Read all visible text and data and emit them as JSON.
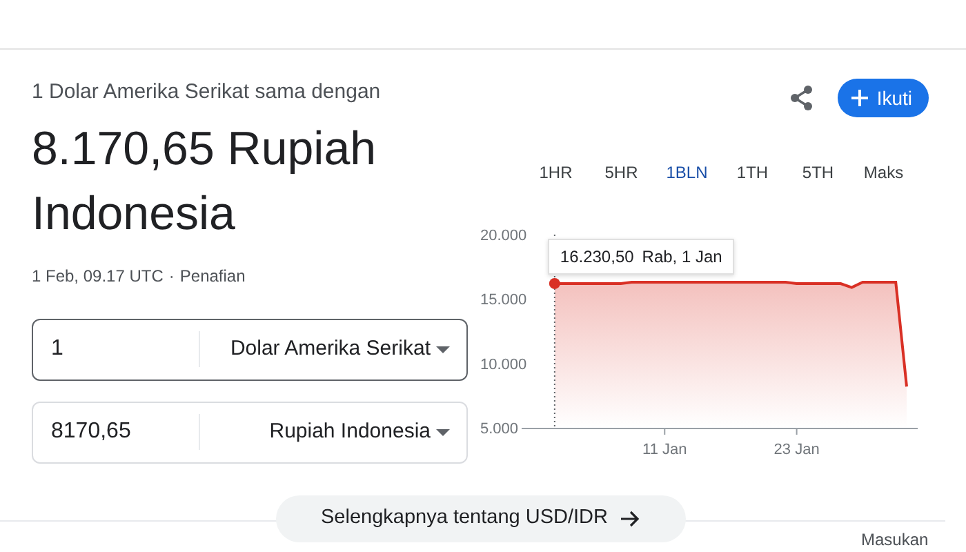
{
  "converter": {
    "intro": "1 Dolar Amerika Serikat sama dengan",
    "result": "8.170,65 Rupiah Indonesia",
    "timestamp": "1 Feb, 09.17 UTC",
    "separator": "·",
    "disclaimer": "Penafian",
    "fields": [
      {
        "value": "1",
        "currency": "Dolar Amerika Serikat",
        "focused": true
      },
      {
        "value": "8170,65",
        "currency": "Rupiah Indonesia",
        "focused": false
      }
    ]
  },
  "follow_button": {
    "label": "Ikuti"
  },
  "ranges": [
    {
      "label": "1HR",
      "selected": false
    },
    {
      "label": "5HR",
      "selected": false
    },
    {
      "label": "1BLN",
      "selected": true
    },
    {
      "label": "1TH",
      "selected": false
    },
    {
      "label": "5TH",
      "selected": false
    },
    {
      "label": "Maks",
      "selected": false
    }
  ],
  "chart": {
    "tooltip": {
      "value": "16.230,50",
      "date": "Rab, 1 Jan"
    },
    "chart_data": {
      "type": "area",
      "categories": [
        null,
        null,
        null,
        null,
        null,
        null,
        null,
        null,
        null,
        null,
        "11 Jan",
        null,
        null,
        null,
        null,
        null,
        null,
        null,
        null,
        null,
        null,
        null,
        "23 Jan",
        null,
        null,
        null,
        null,
        null,
        null,
        null,
        null,
        null,
        null
      ],
      "series": [
        {
          "color": "#d93025",
          "values": [
            16200,
            16200,
            16200,
            16200,
            16200,
            16200,
            16200,
            16300,
            16300,
            16300,
            16300,
            16300,
            16300,
            16300,
            16300,
            16300,
            16300,
            16300,
            16300,
            16300,
            16300,
            16300,
            16200,
            16200,
            16200,
            16200,
            16200,
            15900,
            16300,
            16300,
            16300,
            16300,
            8200
          ]
        }
      ],
      "ylim": [
        5000,
        20000
      ],
      "yticks": [
        {
          "value": 5000,
          "label": "5.000"
        },
        {
          "value": 10000,
          "label": "10.000"
        },
        {
          "value": 15000,
          "label": "15.000"
        },
        {
          "value": 20000,
          "label": "20.000"
        }
      ]
    }
  },
  "more_button": {
    "label": "Selengkapnya tentang USD/IDR"
  },
  "feedback": "Masukan"
}
